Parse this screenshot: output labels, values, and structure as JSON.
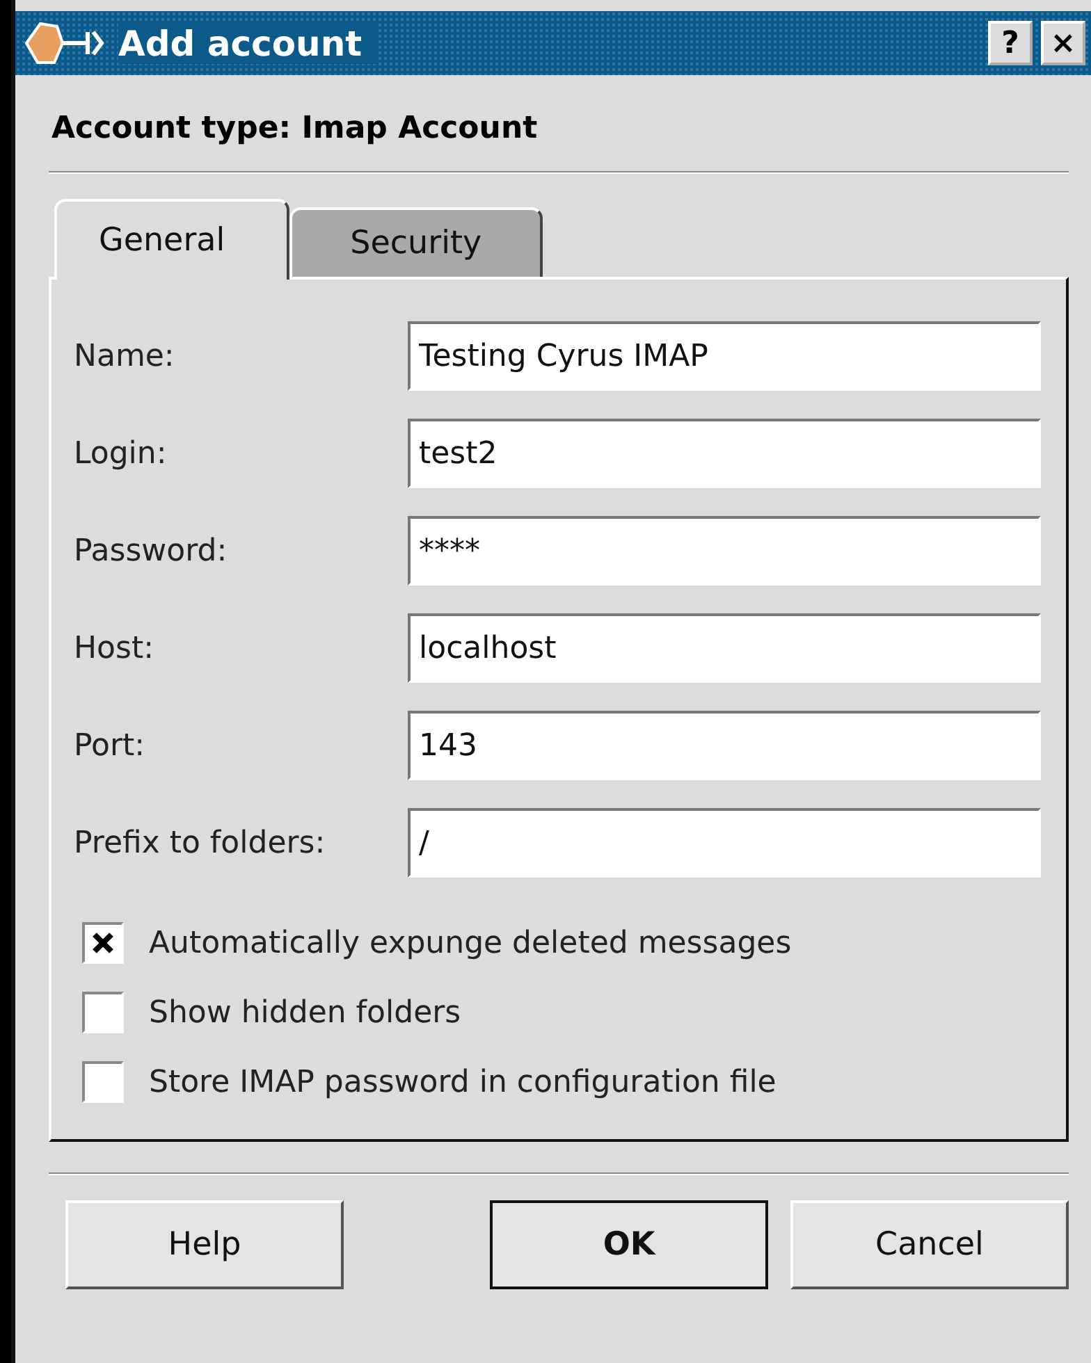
{
  "window": {
    "title": "Add account"
  },
  "title_buttons": [
    "?",
    "×"
  ],
  "header": "Account type: Imap Account",
  "tabs": [
    {
      "label": "General",
      "selected": true
    },
    {
      "label": "Security",
      "selected": false
    }
  ],
  "fields": [
    {
      "label": "Name:",
      "value": "Testing Cyrus IMAP"
    },
    {
      "label": "Login:",
      "value": "test2"
    },
    {
      "label": "Password:",
      "value": "****"
    },
    {
      "label": "Host:",
      "value": "localhost"
    },
    {
      "label": "Port:",
      "value": "143"
    },
    {
      "label": "Prefix to folders:",
      "value": "/"
    }
  ],
  "checkboxes": [
    {
      "label": "Automatically expunge deleted messages",
      "checked": true
    },
    {
      "label": "Show hidden folders",
      "checked": false
    },
    {
      "label": "Store IMAP password in configuration file",
      "checked": false
    }
  ],
  "buttons": [
    {
      "label": "Help",
      "default": false
    },
    {
      "label": "OK",
      "default": true
    },
    {
      "label": "Cancel",
      "default": false
    }
  ]
}
